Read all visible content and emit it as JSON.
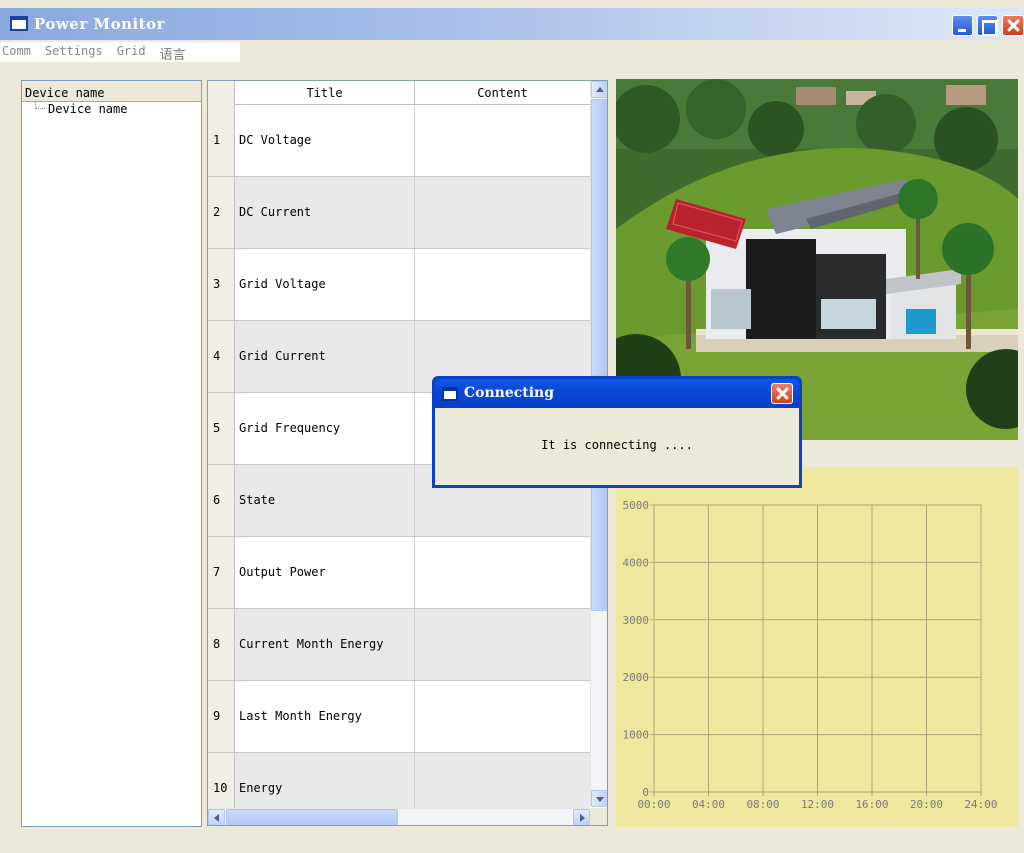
{
  "window": {
    "title": "Power Monitor"
  },
  "menu": {
    "items": [
      "Comm",
      "Settings",
      "Grid",
      "语言"
    ]
  },
  "device_tree": {
    "header": "Device name",
    "nodes": [
      "Device name"
    ]
  },
  "table": {
    "columns": [
      "Title",
      "Content"
    ],
    "rows": [
      {
        "num": "1",
        "title": "DC Voltage",
        "content": ""
      },
      {
        "num": "2",
        "title": "DC Current",
        "content": ""
      },
      {
        "num": "3",
        "title": "Grid Voltage",
        "content": ""
      },
      {
        "num": "4",
        "title": "Grid Current",
        "content": ""
      },
      {
        "num": "5",
        "title": "Grid Frequency",
        "content": ""
      },
      {
        "num": "6",
        "title": "State",
        "content": ""
      },
      {
        "num": "7",
        "title": "Output Power",
        "content": ""
      },
      {
        "num": "8",
        "title": "Current Month Energy",
        "content": ""
      },
      {
        "num": "9",
        "title": "Last Month Energy",
        "content": ""
      },
      {
        "num": "10",
        "title": "Energy",
        "content": ""
      }
    ]
  },
  "dialog": {
    "title": "Connecting",
    "message": "It is connecting ...."
  },
  "colors": {
    "chart_background": "#ede89e",
    "gridline": "#a8a878",
    "dialog_frame": "#0a43c8"
  },
  "chart_data": {
    "type": "line",
    "x": [
      "00:00",
      "04:00",
      "08:00",
      "12:00",
      "16:00",
      "20:00",
      "24:00"
    ],
    "ylim": [
      0,
      5000
    ],
    "yticks": [
      0,
      1000,
      2000,
      3000,
      4000,
      5000
    ],
    "series": [],
    "grid": true,
    "title": "",
    "xlabel": "",
    "ylabel": ""
  }
}
